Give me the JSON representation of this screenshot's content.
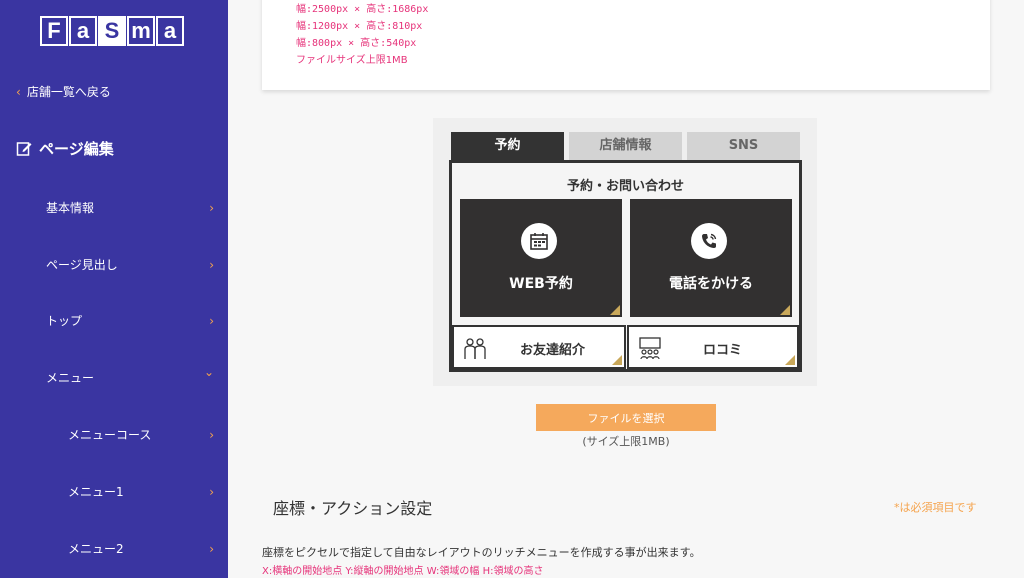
{
  "logo": {
    "letters": [
      "F",
      "a",
      "S",
      "m",
      "a"
    ]
  },
  "sidebar": {
    "back": "店舗一覧へ戻る",
    "section": "ページ編集",
    "items": [
      {
        "label": "基本情報",
        "chevron": "›"
      },
      {
        "label": "ページ見出し",
        "chevron": "›"
      },
      {
        "label": "トップ",
        "chevron": "›"
      },
      {
        "label": "メニュー",
        "chevron": "⌄"
      },
      {
        "label": "メニューコース",
        "chevron": "›"
      },
      {
        "label": "メニュー1",
        "chevron": "›"
      },
      {
        "label": "メニュー2",
        "chevron": "›"
      }
    ]
  },
  "spec": {
    "lines": [
      "幅:2500px × 高さ:1686px",
      "幅:1200px × 高さ:810px",
      "幅:800px × 高さ:540px"
    ],
    "note": "ファイルサイズ上限1MB"
  },
  "preview": {
    "tabs": [
      "予約",
      "店舗情報",
      "SNS"
    ],
    "heading": "予約・お問い合わせ",
    "web_booking": "WEB予約",
    "call": "電話をかける",
    "referral": "お友達紹介",
    "reviews": "ロコミ"
  },
  "upload": {
    "button": "ファイルを選択",
    "limit": "(サイズ上限1MB)"
  },
  "settings": {
    "title": "座標・アクション設定",
    "required": "*は必須項目です",
    "description": "座標をピクセルで指定して自由なレイアウトのリッチメニューを作成する事が出来ます。",
    "legend": "X:横軸の開始地点 Y:縦軸の開始地点 W:領域の幅 H:領域の高さ"
  },
  "colors": {
    "sidebar": "#3a35a1",
    "accent": "#f5a34c",
    "pink": "#e6337a",
    "dark": "#323030",
    "gold": "#c9a85a"
  },
  "icons": [
    "chevron-left-icon",
    "edit-icon",
    "chevron-right-icon",
    "chevron-down-icon",
    "calendar-icon",
    "phone-icon",
    "people-icon",
    "audience-icon"
  ]
}
